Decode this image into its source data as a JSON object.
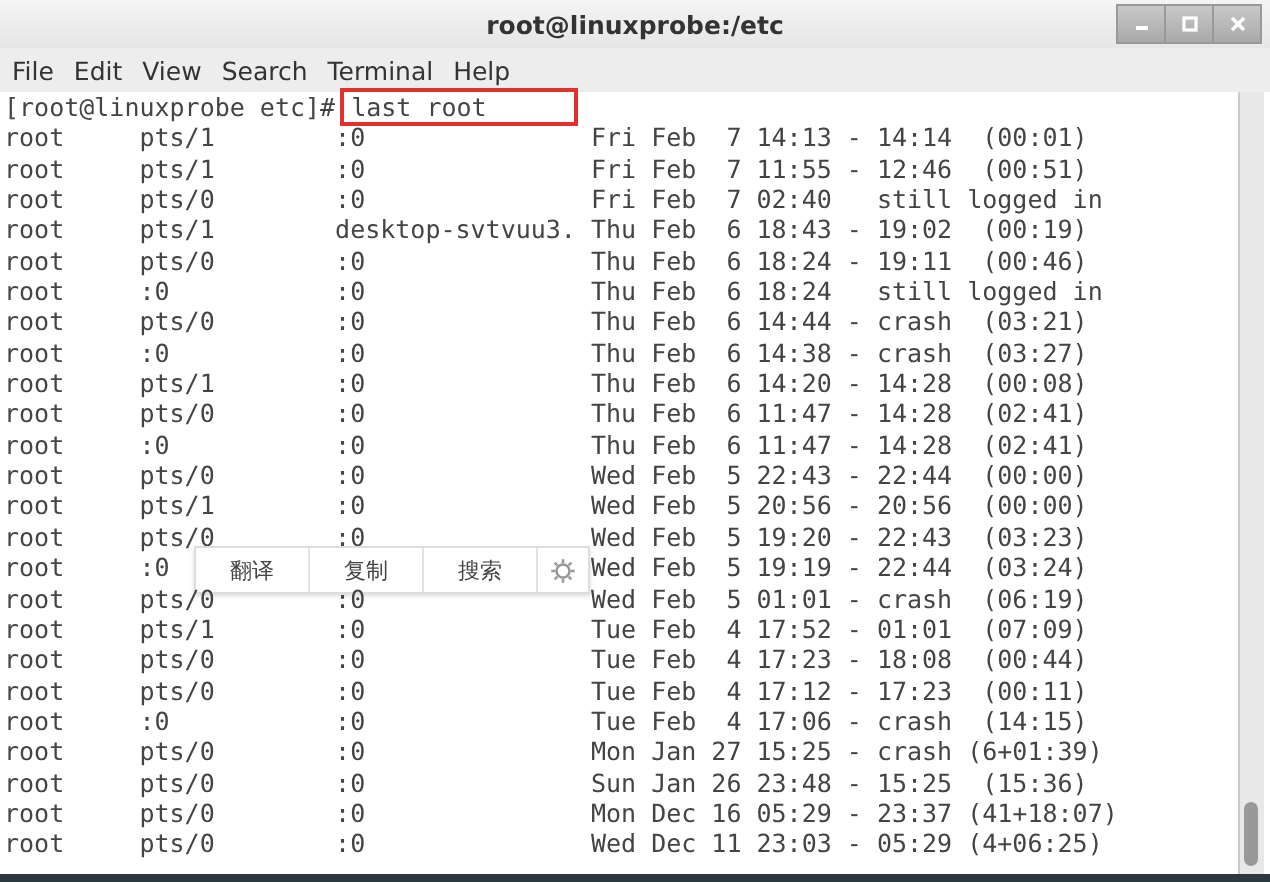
{
  "window": {
    "title": "root@linuxprobe:/etc"
  },
  "menu": [
    "File",
    "Edit",
    "View",
    "Search",
    "Terminal",
    "Help"
  ],
  "terminal": {
    "prompt": "[root@linuxprobe etc]#",
    "command": "last root",
    "rows": [
      {
        "user": "root",
        "tty": "pts/1",
        "host": ":0",
        "time": "Fri Feb  7 14:13 - 14:14  (00:01)"
      },
      {
        "user": "root",
        "tty": "pts/1",
        "host": ":0",
        "time": "Fri Feb  7 11:55 - 12:46  (00:51)"
      },
      {
        "user": "root",
        "tty": "pts/0",
        "host": ":0",
        "time": "Fri Feb  7 02:40   still logged in"
      },
      {
        "user": "root",
        "tty": "pts/1",
        "host": "desktop-svtvuu3.",
        "time": "Thu Feb  6 18:43 - 19:02  (00:19)"
      },
      {
        "user": "root",
        "tty": "pts/0",
        "host": ":0",
        "time": "Thu Feb  6 18:24 - 19:11  (00:46)"
      },
      {
        "user": "root",
        "tty": ":0",
        "host": ":0",
        "time": "Thu Feb  6 18:24   still logged in"
      },
      {
        "user": "root",
        "tty": "pts/0",
        "host": ":0",
        "time": "Thu Feb  6 14:44 - crash  (03:21)"
      },
      {
        "user": "root",
        "tty": ":0",
        "host": ":0",
        "time": "Thu Feb  6 14:38 - crash  (03:27)"
      },
      {
        "user": "root",
        "tty": "pts/1",
        "host": ":0",
        "time": "Thu Feb  6 14:20 - 14:28  (00:08)"
      },
      {
        "user": "root",
        "tty": "pts/0",
        "host": ":0",
        "time": "Thu Feb  6 11:47 - 14:28  (02:41)"
      },
      {
        "user": "root",
        "tty": ":0",
        "host": ":0",
        "time": "Thu Feb  6 11:47 - 14:28  (02:41)"
      },
      {
        "user": "root",
        "tty": "pts/0",
        "host": ":0",
        "time": "Wed Feb  5 22:43 - 22:44  (00:00)"
      },
      {
        "user": "root",
        "tty": "pts/1",
        "host": ":0",
        "time": "Wed Feb  5 20:56 - 20:56  (00:00)"
      },
      {
        "user": "root",
        "tty": "pts/0",
        "host": ":0",
        "time": "Wed Feb  5 19:20 - 22:43  (03:23)"
      },
      {
        "user": "root",
        "tty": ":0",
        "time": "Wed Feb  5 19:19 - 22:44  (03:24)",
        "popup": [
          "翻译",
          "复制",
          "搜索"
        ]
      },
      {
        "user": "root",
        "tty": "pts/0",
        "host": ":0",
        "time": "Wed Feb  5 01:01 - crash  (06:19)"
      },
      {
        "user": "root",
        "tty": "pts/1",
        "host": ":0",
        "time": "Tue Feb  4 17:52 - 01:01  (07:09)"
      },
      {
        "user": "root",
        "tty": "pts/0",
        "host": ":0",
        "time": "Tue Feb  4 17:23 - 18:08  (00:44)"
      },
      {
        "user": "root",
        "tty": "pts/0",
        "host": ":0",
        "time": "Tue Feb  4 17:12 - 17:23  (00:11)"
      },
      {
        "user": "root",
        "tty": ":0",
        "host": ":0",
        "time": "Tue Feb  4 17:06 - crash  (14:15)"
      },
      {
        "user": "root",
        "tty": "pts/0",
        "host": ":0",
        "time": "Mon Jan 27 15:25 - crash (6+01:39)"
      },
      {
        "user": "root",
        "tty": "pts/0",
        "host": ":0",
        "time": "Sun Jan 26 23:48 - 15:25  (15:36)"
      },
      {
        "user": "root",
        "tty": "pts/0",
        "host": ":0",
        "time": "Mon Dec 16 05:29 - 23:37 (41+18:07)"
      },
      {
        "user": "root",
        "tty": "pts/0",
        "host": ":0",
        "time": "Wed Dec 11 23:03 - 05:29 (4+06:25)"
      }
    ]
  }
}
